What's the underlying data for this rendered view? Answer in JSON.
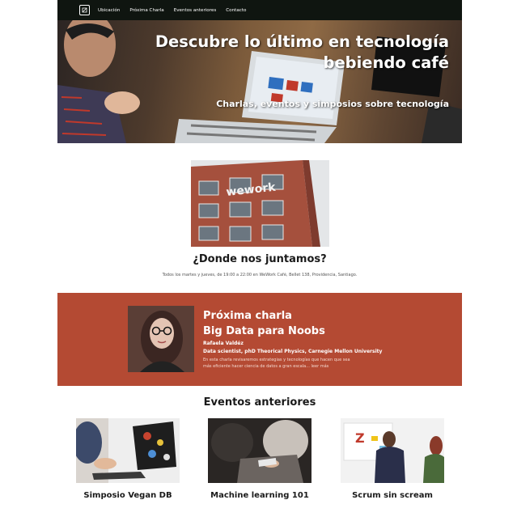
{
  "nav": {
    "logo_icon": "diamond-logo-icon",
    "links": [
      "Ubicación",
      "Próxima Charla",
      "Eventos anteriores",
      "Contacto"
    ]
  },
  "hero": {
    "title": "Descubre lo último en tecnología bebiendo café",
    "subtitle": "Charlas, eventos y simposios sobre tecnología"
  },
  "location": {
    "title": "¿Donde nos juntamos?",
    "text": "Todos los martes y jueves, de 19:00 a 22:00 en WeWork Café, Bellet 138, Providencia, Santiago."
  },
  "next_talk": {
    "kicker": "Próxima charla",
    "title": "Big Data para Noobs",
    "speaker": "Rafaela Valdéz",
    "role": "Data scientist, phD Theorical Physics, Carnegie Mellon University",
    "description": "En esta charla revisaremos estrategias y tecnologías que hacen que sea más eficiente hacer ciencia de datos a gran escala... leer más"
  },
  "past": {
    "title": "Eventos anteriores",
    "events": [
      "Simposio Vegan DB",
      "Machine learning 101",
      "Scrum sin scream"
    ]
  },
  "colors": {
    "nav_bg": "#0f1510",
    "accent": "#b44a33"
  }
}
